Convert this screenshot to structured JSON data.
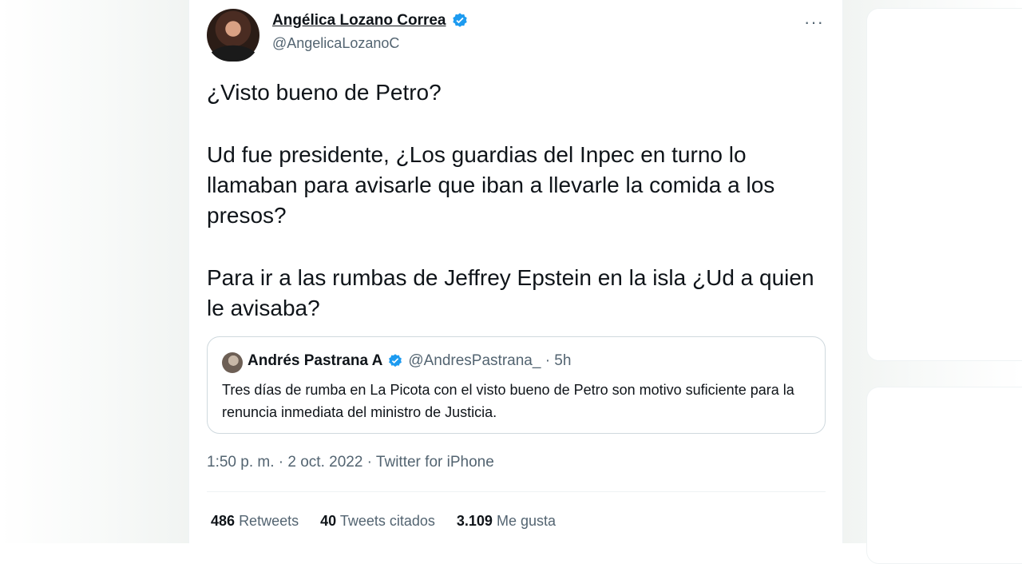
{
  "tweet": {
    "author": {
      "name": "Angélica Lozano Correa",
      "handle": "@AngelicaLozanoC"
    },
    "more_label": "···",
    "paragraphs": [
      "¿Visto bueno de Petro?",
      "Ud fue presidente, ¿Los guardias del Inpec en turno lo llamaban para avisarle que iban a llevarle la comida a los presos?",
      "Para ir a las rumbas de Jeffrey Epstein en la isla ¿Ud a quien le avisaba?"
    ],
    "quoted": {
      "name": "Andrés Pastrana A",
      "handle_time": "@AndresPastrana_ · 5h",
      "text": "Tres días de rumba en La Picota con el visto bueno de Petro son motivo suficiente para la renuncia inmediata del ministro de Justicia."
    },
    "meta": "1:50 p. m. · 2 oct. 2022 · Twitter for iPhone",
    "stats": [
      {
        "count": "486",
        "label": "Retweets"
      },
      {
        "count": "40",
        "label": "Tweets citados"
      },
      {
        "count": "3.109",
        "label": "Me gusta"
      }
    ]
  },
  "icons": {
    "verified": "verified-badge-icon",
    "more": "more-options-icon"
  },
  "colors": {
    "verified_blue": "#1d9bf0",
    "text": "#0f1419",
    "secondary": "#536471",
    "border": "#cfd9de"
  }
}
